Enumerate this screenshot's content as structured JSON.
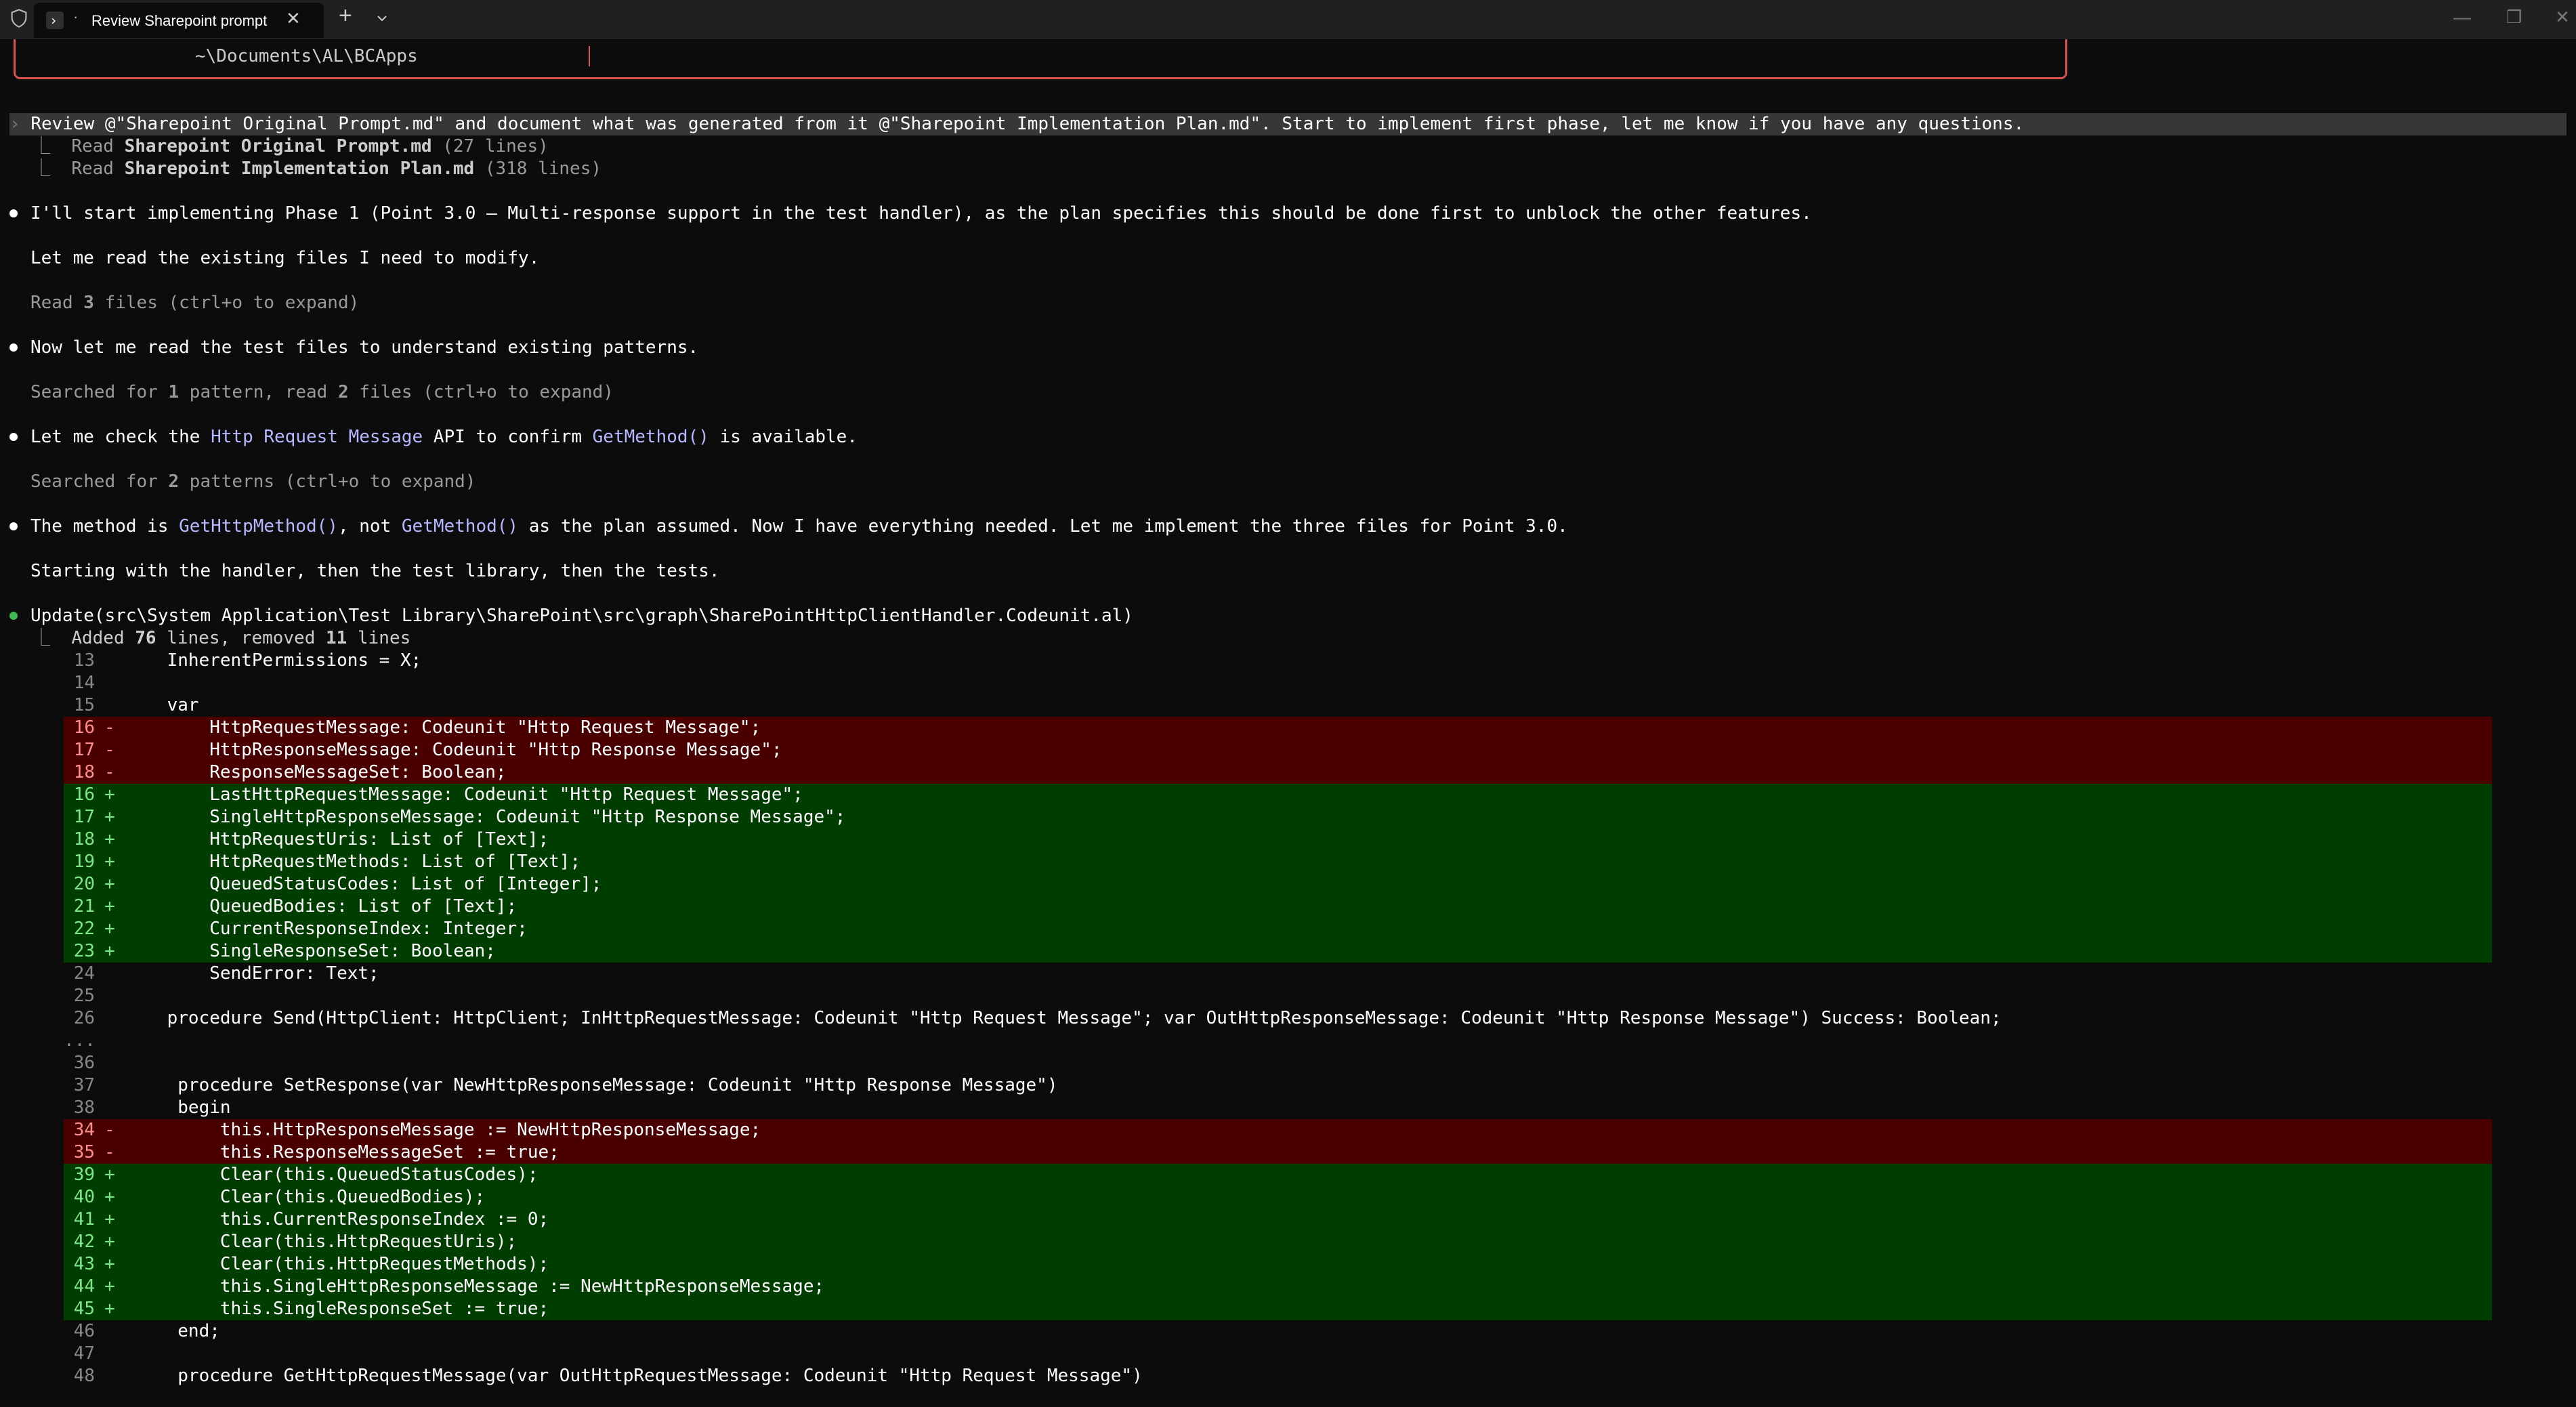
{
  "window": {
    "tab_title": "Review Sharepoint prompt",
    "tab_dot": "·",
    "close_glyph": "✕",
    "new_tab_glyph": "+",
    "minimize_glyph": "—",
    "maximize_glyph": "❐",
    "close_window_glyph": "✕",
    "icons": [
      "shield-icon",
      "terminal-icon",
      "close-icon",
      "plus-icon",
      "chevron-down-icon"
    ]
  },
  "prompt": {
    "path": "~\\Documents\\AL\\BCApps"
  },
  "conversation": {
    "user_chevron": "›",
    "user_message": "Review @\"Sharepoint Original Prompt.md\" and document what was generated from it @\"Sharepoint Implementation Plan.md\". Start to implement first phase, let me know if you have any questions.",
    "tree_glyph": "⎿",
    "read_label": "Read",
    "read1_file": "Sharepoint Original Prompt.md",
    "read1_count": "(27 lines)",
    "read2_file": "Sharepoint Implementation Plan.md",
    "read2_count": "(318 lines)",
    "msg1": "I'll start implementing Phase 1 (Point 3.0 — Multi-response support in the test handler), as the plan specifies this should be done first to unblock the other features.",
    "msg2": "Let me read the existing files I need to modify.",
    "tool1_a": "Read ",
    "tool1_num": "3",
    "tool1_b": " files (ctrl+o to expand)",
    "msg3": "Now let me read the test files to understand existing patterns.",
    "tool2_a": "Searched for ",
    "tool2_num1": "1",
    "tool2_b": " pattern, read ",
    "tool2_num2": "2",
    "tool2_c": " files (ctrl+o to expand)",
    "msg4_a": "Let me check the ",
    "msg4_code1": "Http Request Message",
    "msg4_b": " API to confirm ",
    "msg4_code2": "GetMethod()",
    "msg4_c": " is available.",
    "tool3_a": "Searched for ",
    "tool3_num": "2",
    "tool3_b": " patterns (ctrl+o to expand)",
    "msg5_a": "The method is ",
    "msg5_code1": "GetHttpMethod()",
    "msg5_b": ", not ",
    "msg5_code2": "GetMethod()",
    "msg5_c": " as the plan assumed. Now I have everything needed. Let me implement the three files for Point 3.0.",
    "msg6": "Starting with the handler, then the test library, then the tests.",
    "update_line": "Update(src\\System Application\\Test Library\\SharePoint\\src\\graph\\SharePointHttpClientHandler.Codeunit.al)",
    "update_summary_a": "Added ",
    "update_added": "76",
    "update_summary_b": " lines, removed ",
    "update_removed": "11",
    "update_summary_c": " lines"
  },
  "diff": [
    {
      "ln": "13",
      "sign": "",
      "type": "ctx",
      "code": "    InherentPermissions = X;"
    },
    {
      "ln": "14",
      "sign": "",
      "type": "ctx",
      "code": ""
    },
    {
      "ln": "15",
      "sign": "",
      "type": "ctx",
      "code": "    var"
    },
    {
      "ln": "16",
      "sign": "-",
      "type": "rem",
      "code": "        HttpRequestMessage: Codeunit \"Http Request Message\";"
    },
    {
      "ln": "17",
      "sign": "-",
      "type": "rem",
      "code": "        HttpResponseMessage: Codeunit \"Http Response Message\";"
    },
    {
      "ln": "18",
      "sign": "-",
      "type": "rem",
      "code": "        ResponseMessageSet: Boolean;"
    },
    {
      "ln": "16",
      "sign": "+",
      "type": "add",
      "code": "        LastHttpRequestMessage: Codeunit \"Http Request Message\";"
    },
    {
      "ln": "17",
      "sign": "+",
      "type": "add",
      "code": "        SingleHttpResponseMessage: Codeunit \"Http Response Message\";"
    },
    {
      "ln": "18",
      "sign": "+",
      "type": "add",
      "code": "        HttpRequestUris: List of [Text];"
    },
    {
      "ln": "19",
      "sign": "+",
      "type": "add",
      "code": "        HttpRequestMethods: List of [Text];"
    },
    {
      "ln": "20",
      "sign": "+",
      "type": "add",
      "code": "        QueuedStatusCodes: List of [Integer];"
    },
    {
      "ln": "21",
      "sign": "+",
      "type": "add",
      "code": "        QueuedBodies: List of [Text];"
    },
    {
      "ln": "22",
      "sign": "+",
      "type": "add",
      "code": "        CurrentResponseIndex: Integer;"
    },
    {
      "ln": "23",
      "sign": "+",
      "type": "add",
      "code": "        SingleResponseSet: Boolean;"
    },
    {
      "ln": "24",
      "sign": "",
      "type": "ctx",
      "code": "        SendError: Text;"
    },
    {
      "ln": "25",
      "sign": "",
      "type": "ctx",
      "code": ""
    },
    {
      "ln": "26",
      "sign": "",
      "type": "ctx",
      "code": "    procedure Send(HttpClient: HttpClient; InHttpRequestMessage: Codeunit \"Http Request Message\"; var OutHttpResponseMessage: Codeunit \"Http Response Message\") Success: Boolean;"
    },
    {
      "ln": "...",
      "sign": "",
      "type": "ellipsis",
      "code": ""
    },
    {
      "ln": "36",
      "sign": "",
      "type": "ctx",
      "code": ""
    },
    {
      "ln": "37",
      "sign": "",
      "type": "ctx",
      "code": "     procedure SetResponse(var NewHttpResponseMessage: Codeunit \"Http Response Message\")"
    },
    {
      "ln": "38",
      "sign": "",
      "type": "ctx",
      "code": "     begin"
    },
    {
      "ln": "34",
      "sign": "-",
      "type": "rem",
      "code": "         this.HttpResponseMessage := NewHttpResponseMessage;"
    },
    {
      "ln": "35",
      "sign": "-",
      "type": "rem",
      "code": "         this.ResponseMessageSet := true;"
    },
    {
      "ln": "39",
      "sign": "+",
      "type": "add",
      "code": "         Clear(this.QueuedStatusCodes);"
    },
    {
      "ln": "40",
      "sign": "+",
      "type": "add",
      "code": "         Clear(this.QueuedBodies);"
    },
    {
      "ln": "41",
      "sign": "+",
      "type": "add",
      "code": "         this.CurrentResponseIndex := 0;"
    },
    {
      "ln": "42",
      "sign": "+",
      "type": "add",
      "code": "         Clear(this.HttpRequestUris);"
    },
    {
      "ln": "43",
      "sign": "+",
      "type": "add",
      "code": "         Clear(this.HttpRequestMethods);"
    },
    {
      "ln": "44",
      "sign": "+",
      "type": "add",
      "code": "         this.SingleHttpResponseMessage := NewHttpResponseMessage;"
    },
    {
      "ln": "45",
      "sign": "+",
      "type": "add",
      "code": "         this.SingleResponseSet := true;"
    },
    {
      "ln": "46",
      "sign": "",
      "type": "ctx",
      "code": "     end;"
    },
    {
      "ln": "47",
      "sign": "",
      "type": "ctx",
      "code": ""
    },
    {
      "ln": "48",
      "sign": "",
      "type": "ctx",
      "code": "     procedure GetHttpRequestMessage(var OutHttpRequestMessage: Codeunit \"Http Request Message\")"
    }
  ],
  "colors": {
    "background": "#0c0c0c",
    "removed_bg": "#4b0000",
    "added_bg": "#003d00",
    "accent_red": "#d9534f",
    "code_blue": "#b4b8ff",
    "bullet_green": "#3fb950"
  }
}
